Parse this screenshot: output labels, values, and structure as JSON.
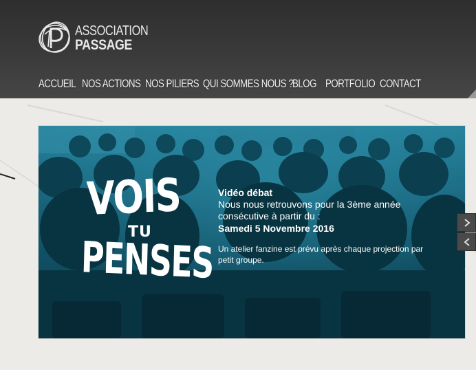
{
  "brand": {
    "line1": "ASSOCIATION",
    "line2": "PASSAGE",
    "logo_icon": "passage-scribble-p-logo"
  },
  "nav": {
    "items": [
      {
        "label": "ACCUEIL"
      },
      {
        "label": "NOS ACTIONS"
      },
      {
        "label": "NOS PILIERS"
      },
      {
        "label": "QUI SOMMES NOUS ?"
      },
      {
        "label": "BLOG"
      },
      {
        "label": "PORTFOLIO"
      },
      {
        "label": "CONTACT"
      }
    ]
  },
  "slide": {
    "title_art": {
      "word1": "VOIS",
      "word2": "TU",
      "word3": "PENSES"
    },
    "heading": "Vidéo débat",
    "line1": "Nous nous retrouvons pour la 3ème année",
    "line2": "consécutive à partir du :",
    "date": "Samedi 5 Novembre 2016",
    "note": "Un atelier fanzine est prévu après chaque projection par petit groupe."
  },
  "slider_controls": {
    "next_icon": "chevron-right-icon",
    "prev_icon": "chevron-left-icon"
  },
  "colors": {
    "header_bg": "#3a3a3a",
    "page_bg": "#ecebe7",
    "slide_tint": "#1a7f98",
    "text_light": "#ffffff"
  }
}
